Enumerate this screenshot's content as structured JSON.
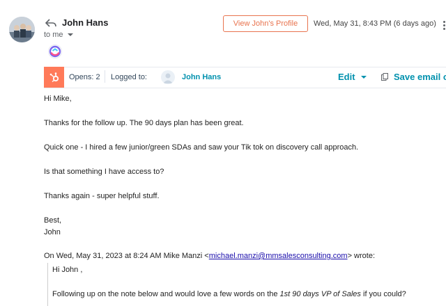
{
  "message": {
    "sender_name": "John Hans",
    "to_label": "to me",
    "profile_button": "View John's Profile",
    "date": "Wed, May 31, 8:43 PM (6 days ago)"
  },
  "hubspot_bar": {
    "opens": "Opens: 2",
    "logged_to": "Logged to:",
    "contact_name": "John Hans",
    "edit_label": "Edit",
    "save_label": "Save email c"
  },
  "body": {
    "greeting": "Hi Mike,",
    "p1": "Thanks for the follow up. The 90 days plan has been great.",
    "p2": "Quick one - I hired a few junior/green SDAs and saw your Tik tok on discovery call approach.",
    "p3": "Is that something I have access to?",
    "p4": "Thanks again - super helpful stuff.",
    "sign_1": "Best,",
    "sign_2": "John"
  },
  "quote": {
    "attribution_prefix": "On Wed, May 31, 2023 at 8:24 AM Mike Manzi <",
    "email": "michael.manzi@mmsalesconsulting.com",
    "attribution_suffix": "> wrote:",
    "greeting": "Hi John ,",
    "line_prefix": "Following up on the note below and would love a few words on the ",
    "line_italic": "1st 90 days VP of Sales",
    "line_suffix": " if you could?"
  },
  "colors": {
    "hubspot_orange": "#ff7a59",
    "profile_accent": "#e8734e",
    "link_teal": "#0091ae"
  }
}
